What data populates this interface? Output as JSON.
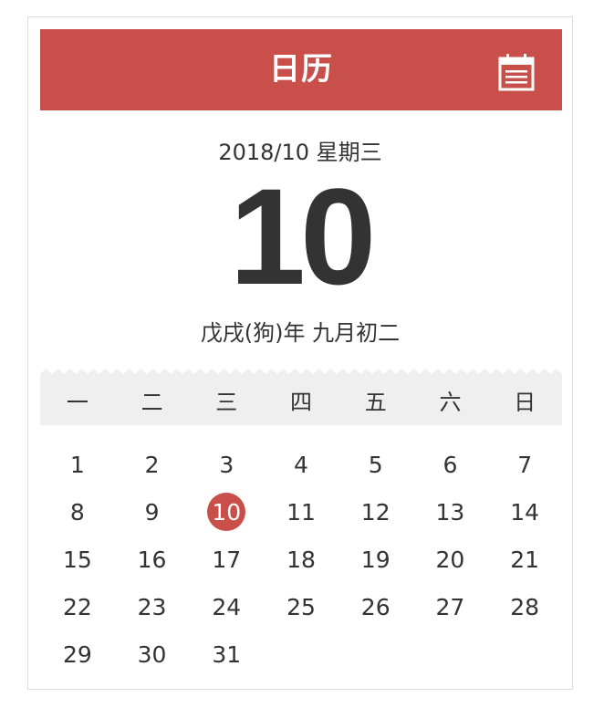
{
  "header": {
    "title": "日历",
    "icon": "calendar-icon"
  },
  "date_line": "2018/10 星期三",
  "big_day": "10",
  "lunar_line": "戊戌(狗)年 九月初二",
  "weekdays": [
    "一",
    "二",
    "三",
    "四",
    "五",
    "六",
    "日"
  ],
  "days": [
    "1",
    "2",
    "3",
    "4",
    "5",
    "6",
    "7",
    "8",
    "9",
    "10",
    "11",
    "12",
    "13",
    "14",
    "15",
    "16",
    "17",
    "18",
    "19",
    "20",
    "21",
    "22",
    "23",
    "24",
    "25",
    "26",
    "27",
    "28",
    "29",
    "30",
    "31"
  ],
  "today_index": 9,
  "colors": {
    "accent": "#c9504a",
    "weekbar": "#efefef",
    "text": "#333333"
  }
}
